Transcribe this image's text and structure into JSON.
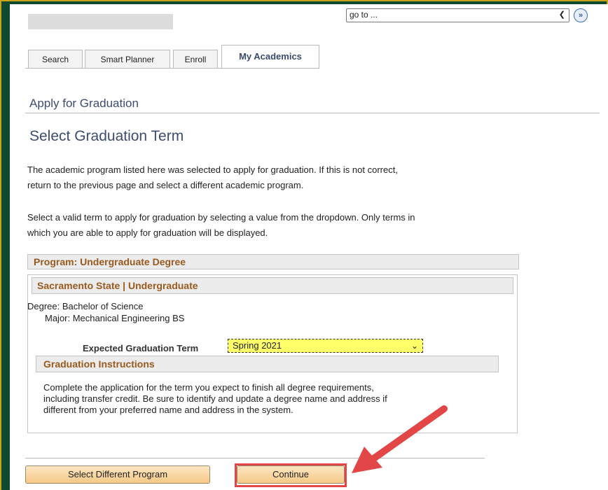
{
  "nav": {
    "goto_value": "go to ...",
    "goto_button_icon": "double-chevron-right-icon"
  },
  "tabs": [
    {
      "label": "Search",
      "active": false
    },
    {
      "label": "Smart Planner",
      "active": false
    },
    {
      "label": "Enroll",
      "active": false
    },
    {
      "label": "My Academics",
      "active": true
    }
  ],
  "section_title": "Apply for Graduation",
  "page_title": "Select Graduation Term",
  "intro": {
    "para1_line1": "The academic program listed here was selected to apply for graduation. If this is not correct,",
    "para1_line2": "return to the previous page and select a different academic program.",
    "para2_line1": "Select a valid term to apply for graduation by selecting a value from the dropdown. Only terms in",
    "para2_line2": "which you are able to apply for graduation will be displayed."
  },
  "program": {
    "header": "Program: Undergraduate Degree",
    "institution": "Sacramento State | Undergraduate",
    "degree": "Degree: Bachelor of Science",
    "major": "Major: Mechanical Engineering BS",
    "term_label": "Expected Graduation Term",
    "term_value": "Spring 2021"
  },
  "instructions": {
    "header": "Graduation Instructions",
    "line1": "Complete the application for the term you expect to finish all degree requirements,",
    "line2": "including transfer credit. Be sure to identify and update a degree name and address if",
    "line3": "different from your preferred name and address in the system."
  },
  "buttons": {
    "select_program": "Select Different Program",
    "continue": "Continue"
  },
  "colors": {
    "frame_green": "#0f4a2e",
    "frame_gold": "#c9a417",
    "heading_blue": "#3c4d6e",
    "group_title_brown": "#9a5a1e",
    "highlight_yellow": "#ffff6a",
    "annotation_red": "#e34646"
  }
}
